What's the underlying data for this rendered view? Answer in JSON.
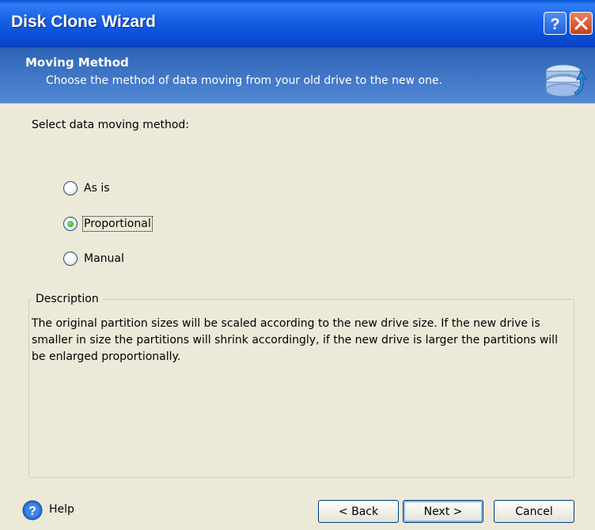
{
  "window": {
    "title": "Disk Clone Wizard",
    "help_button_glyph": "?",
    "close_button_glyph": "✕"
  },
  "header": {
    "title": "Moving Method",
    "subtitle": "Choose the method of data moving from your old drive to the new one.",
    "icon": "disk-clone-icon"
  },
  "content": {
    "select_label": "Select data moving method:",
    "options": [
      {
        "label": "As is",
        "selected": false
      },
      {
        "label": "Proportional",
        "selected": true
      },
      {
        "label": "Manual",
        "selected": false
      }
    ],
    "description": {
      "legend": "Description",
      "text": "The original partition sizes will be scaled according to the new drive size. If the new drive is smaller in size the partitions will shrink accordingly, if the new drive is larger the partitions will be enlarged proportionally."
    }
  },
  "footer": {
    "help_label": "Help",
    "back_label": "< Back",
    "next_label": "Next >",
    "cancel_label": "Cancel"
  },
  "colors": {
    "titlebar": "#0b4fd8",
    "header": "#2d63b6",
    "background": "#ece9d8",
    "selected_radio": "#21a121"
  }
}
